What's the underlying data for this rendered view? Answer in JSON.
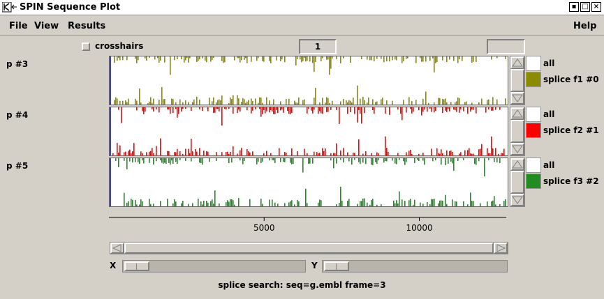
{
  "window": {
    "title": "SPIN Sequence Plot",
    "btn_min": "▪",
    "btn_max": "□",
    "btn_close": "×"
  },
  "menu": {
    "file": "File",
    "view": "View",
    "results": "Results",
    "help": "Help"
  },
  "toolbar": {
    "crosshairs_label": "crosshairs",
    "frame_value": "1",
    "extra_value": ""
  },
  "plots": [
    {
      "label": "p #3",
      "color": "#8b8b00",
      "legend_all": "all",
      "legend_series": "splice f1 #0"
    },
    {
      "label": "p #4",
      "color": "#ff0000",
      "legend_all": "all",
      "legend_series": "splice f2 #1"
    },
    {
      "label": "p #5",
      "color": "#228b22",
      "legend_all": "all",
      "legend_series": "splice f3 #2"
    }
  ],
  "axis": {
    "ticks": [
      "5000",
      "10000"
    ],
    "tick_values": [
      5000,
      10000
    ],
    "max": 12800
  },
  "scroll": {
    "x_label": "X",
    "y_label": "Y"
  },
  "status": "splice search: seq=g.embl frame=3"
}
